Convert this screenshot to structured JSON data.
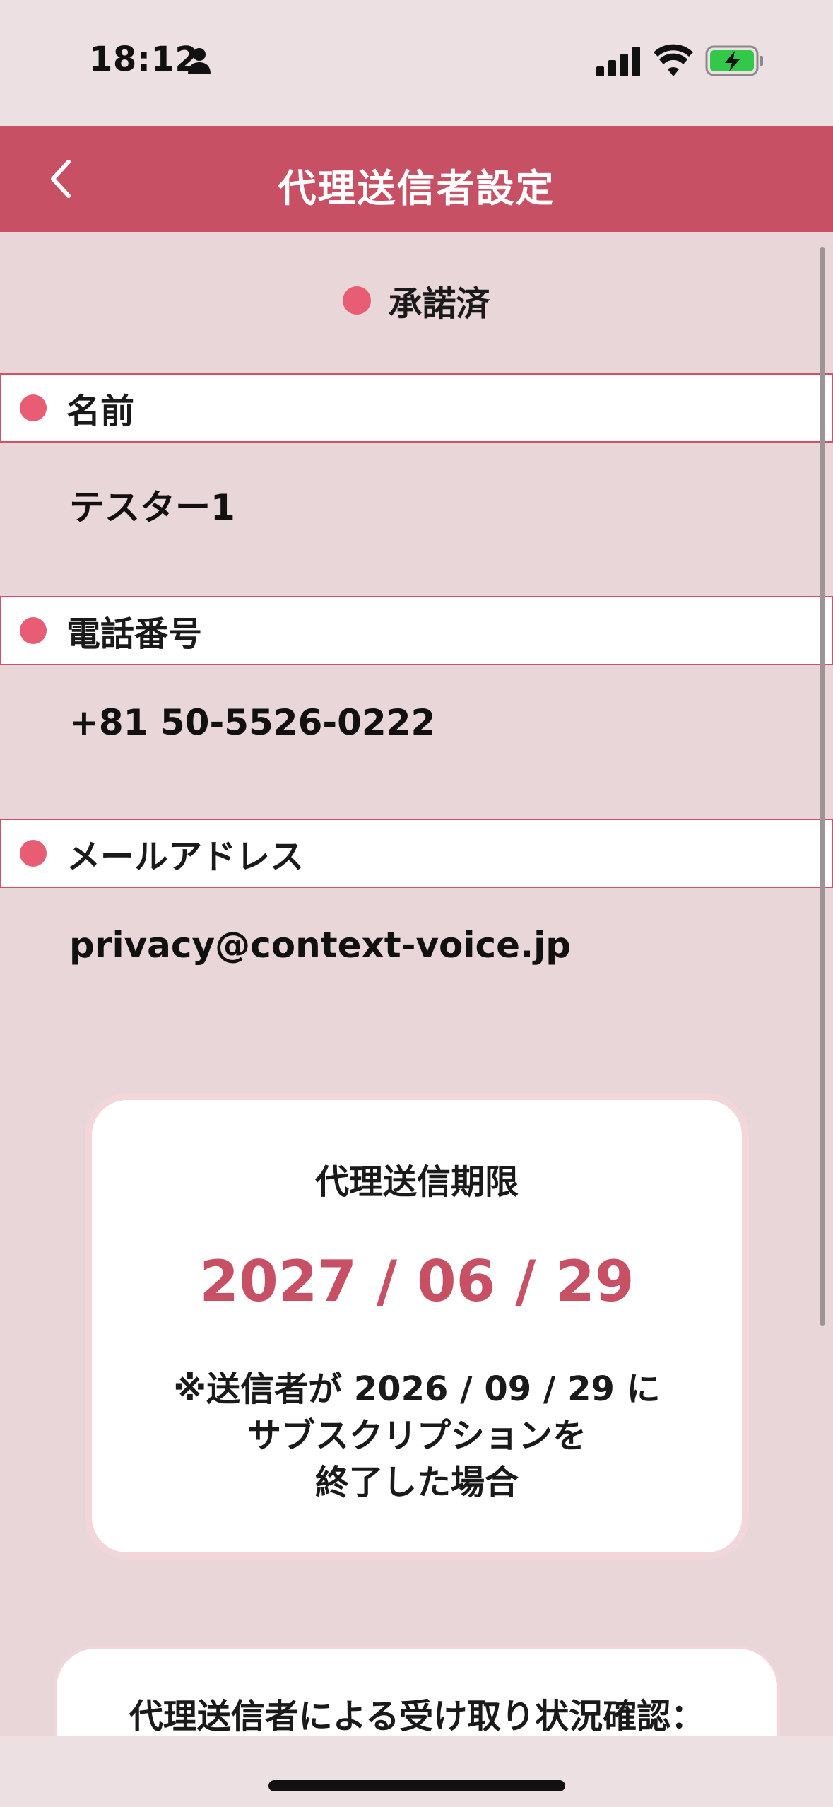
{
  "status_bar": {
    "time": "18:12"
  },
  "header": {
    "title": "代理送信者設定"
  },
  "status": {
    "text": "承諾済"
  },
  "fields": {
    "name": {
      "label": "名前",
      "value": "テスター1"
    },
    "phone": {
      "label": "電話番号",
      "value": "+81 50-5526-0222"
    },
    "email": {
      "label": "メールアドレス",
      "value": "privacy@context-voice.jp"
    }
  },
  "expiry": {
    "label": "代理送信期限",
    "date": "2027 / 06 / 29",
    "note_line1": "※送信者が 2026 / 09 / 29 に",
    "note_line2": "サブスクリプションを",
    "note_line3": "終了した場合"
  },
  "receipt": {
    "title": "代理送信者による受け取り状況確認："
  },
  "colors": {
    "header": "#c85064",
    "accent_dot": "#e85d73",
    "background": "#e8d6d9",
    "date_text": "#c85064"
  },
  "icons": {
    "back": "chevron-left-icon",
    "person": "person-icon",
    "signal": "signal-icon",
    "wifi": "wifi-icon",
    "battery": "battery-charging-icon"
  }
}
